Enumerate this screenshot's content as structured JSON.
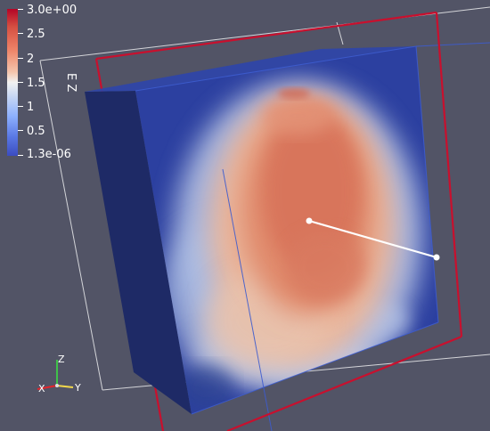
{
  "legend": {
    "title": "E Z",
    "labels": [
      "3.0e+00",
      "2.5",
      "2",
      "1.5",
      "1",
      "0.5",
      "1.3e-06"
    ]
  },
  "orientation_axes": {
    "x_label": "X",
    "y_label": "Y",
    "z_label": "Z",
    "x_color": "#e3242b",
    "y_color": "#f2d84b",
    "z_color": "#3fc14a"
  },
  "colors": {
    "background": "#525466",
    "volume_bounds": "#c8102e",
    "outline": "#ffffff",
    "slab_blue": "#2b3f9a"
  }
}
